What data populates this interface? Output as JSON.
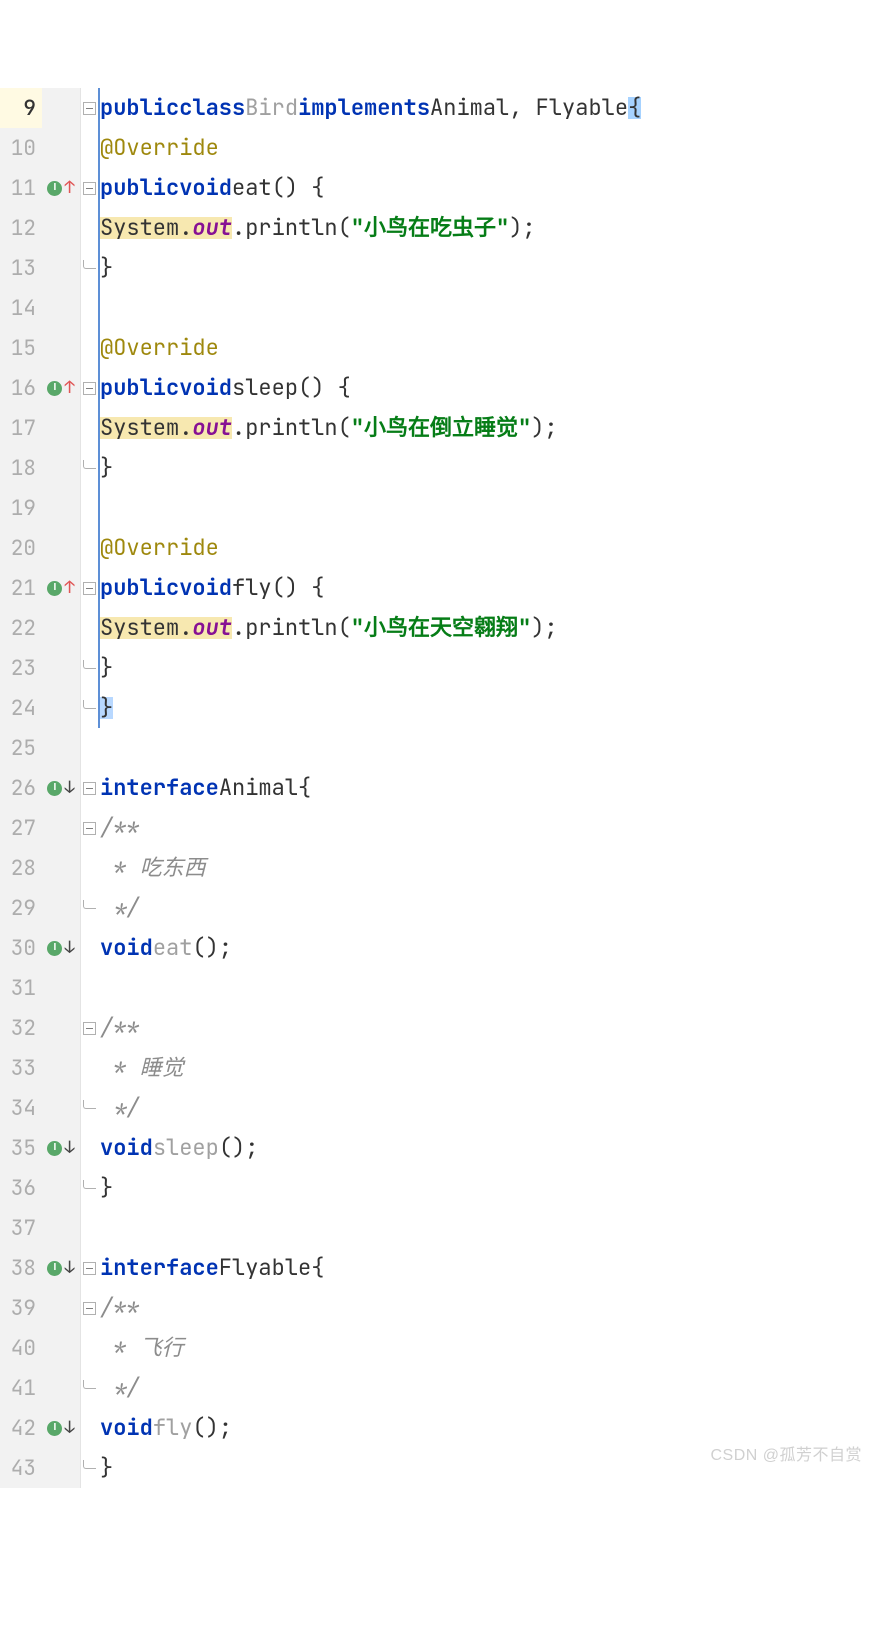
{
  "watermark": "CSDN @孤芳不自赏",
  "kw": {
    "public": "public",
    "class": "class",
    "implements": "implements",
    "void": "void",
    "interface": "interface"
  },
  "sym": {
    "Bird": "Bird",
    "Animal": "Animal",
    "Flyable": "Flyable",
    "System": "System",
    "out": "out",
    "println": "println",
    "eat": "eat",
    "sleep": "sleep",
    "fly": "fly",
    "Override": "@Override"
  },
  "str": {
    "eat": "\"小鸟在吃虫子\"",
    "sleep": "\"小鸟在倒立睡觉\"",
    "fly": "\"小鸟在天空翱翔\""
  },
  "cmt": {
    "open": "/**",
    "close": " */",
    "eat": " * 吃东西",
    "sleep": " * 睡觉",
    "fly": " * 飞行"
  },
  "ln": {
    "9": "9",
    "10": "10",
    "11": "11",
    "12": "12",
    "13": "13",
    "14": "14",
    "15": "15",
    "16": "16",
    "17": "17",
    "18": "18",
    "19": "19",
    "20": "20",
    "21": "21",
    "22": "22",
    "23": "23",
    "24": "24",
    "25": "25",
    "26": "26",
    "27": "27",
    "28": "28",
    "29": "29",
    "30": "30",
    "31": "31",
    "32": "32",
    "33": "33",
    "34": "34",
    "35": "35",
    "36": "36",
    "37": "37",
    "38": "38",
    "39": "39",
    "40": "40",
    "41": "41",
    "42": "42",
    "43": "43"
  }
}
